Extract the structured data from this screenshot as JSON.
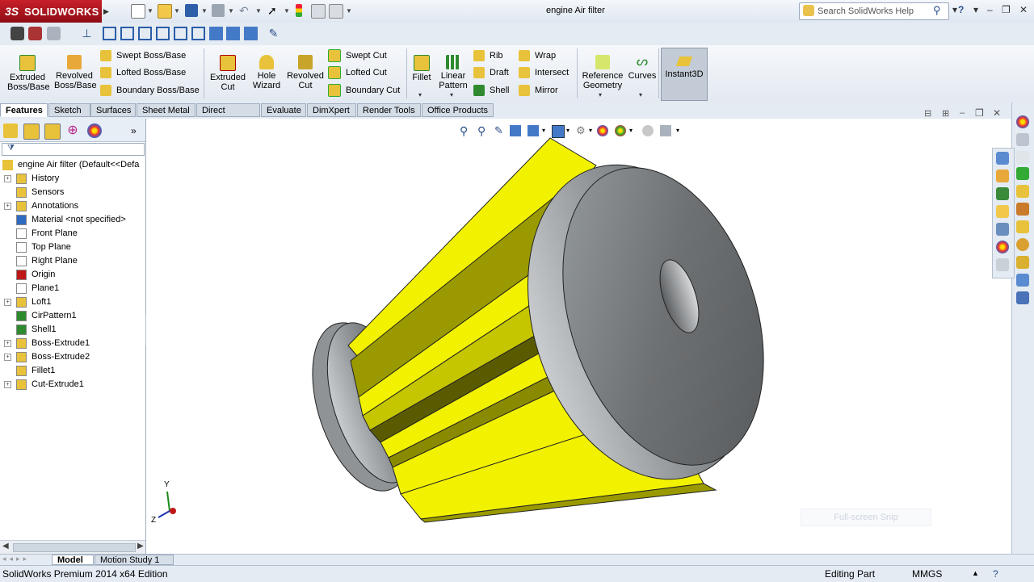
{
  "app": {
    "logo_mark": "3S",
    "logo_text": "SOLIDWORKS",
    "doc_title": "engine Air filter",
    "search_placeholder": "Search SolidWorks Help",
    "help_glyph": "?"
  },
  "commands": {
    "extruded_boss": "Extruded Boss/Base",
    "revolved_boss": "Revolved Boss/Base",
    "swept_boss": "Swept Boss/Base",
    "lofted_boss": "Lofted Boss/Base",
    "boundary_boss": "Boundary Boss/Base",
    "extruded_cut": "Extruded Cut",
    "hole_wizard": "Hole Wizard",
    "revolved_cut": "Revolved Cut",
    "swept_cut": "Swept Cut",
    "lofted_cut": "Lofted Cut",
    "boundary_cut": "Boundary Cut",
    "fillet": "Fillet",
    "linear_pattern": "Linear Pattern",
    "rib": "Rib",
    "draft": "Draft",
    "shell": "Shell",
    "wrap": "Wrap",
    "intersect": "Intersect",
    "mirror": "Mirror",
    "reference_geometry": "Reference Geometry",
    "curves": "Curves",
    "instant3d": "Instant3D"
  },
  "tabs": [
    "Features",
    "Sketch",
    "Surfaces",
    "Sheet Metal",
    "Direct Editing",
    "Evaluate",
    "DimXpert",
    "Render Tools",
    "Office Products"
  ],
  "tree": {
    "root": "engine Air filter  (Default<<Defa",
    "items": [
      {
        "label": "History",
        "expandable": true
      },
      {
        "label": "Sensors",
        "expandable": false
      },
      {
        "label": "Annotations",
        "expandable": true
      },
      {
        "label": "Material <not specified>",
        "expandable": false
      },
      {
        "label": "Front Plane",
        "expandable": false
      },
      {
        "label": "Top Plane",
        "expandable": false
      },
      {
        "label": "Right Plane",
        "expandable": false
      },
      {
        "label": "Origin",
        "expandable": false
      },
      {
        "label": "Plane1",
        "expandable": false
      },
      {
        "label": "Loft1",
        "expandable": true
      },
      {
        "label": "CirPattern1",
        "expandable": false
      },
      {
        "label": "Shell1",
        "expandable": false
      },
      {
        "label": "Boss-Extrude1",
        "expandable": true
      },
      {
        "label": "Boss-Extrude2",
        "expandable": true
      },
      {
        "label": "Fillet1",
        "expandable": false
      },
      {
        "label": "Cut-Extrude1",
        "expandable": true
      }
    ]
  },
  "bottom_tabs": [
    "Model",
    "Motion Study 1"
  ],
  "status": {
    "edition": "SolidWorks Premium 2014 x64 Edition",
    "mode": "Editing Part",
    "units": "MMGS"
  },
  "overlay": {
    "snip": "Full-screen Snip"
  },
  "triad": {
    "y": "Y",
    "z": "Z"
  },
  "colors": {
    "filter_yellow": "#f2f200",
    "filter_dark": "#5a5a00",
    "cap_gray": "#6e7173",
    "brand_red": "#c8202a"
  }
}
